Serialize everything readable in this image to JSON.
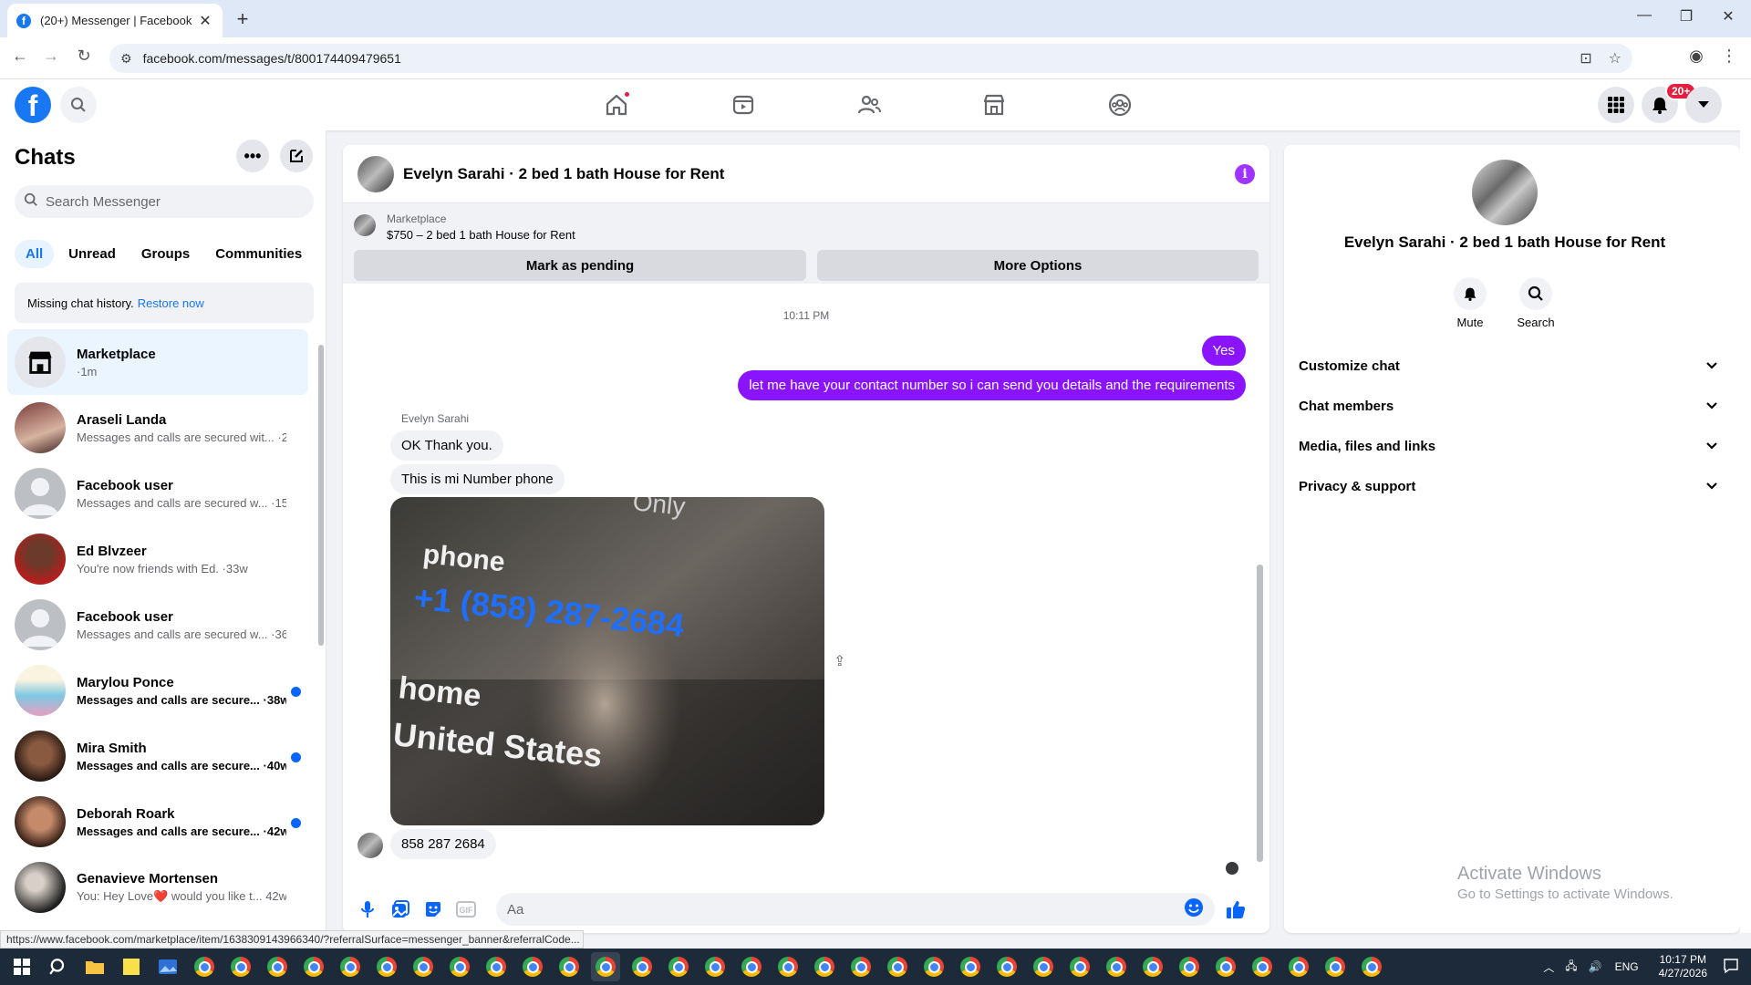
{
  "browser": {
    "tab_title": "(20+) Messenger | Facebook",
    "url": "facebook.com/messages/t/800174409479651",
    "status_url": "https://www.facebook.com/marketplace/item/1638309143966340/?referralSurface=messenger_banner&referralCode..."
  },
  "fb": {
    "notification_count": "20+",
    "logo_letter": "f"
  },
  "left": {
    "title": "Chats",
    "search_placeholder": "Search Messenger",
    "filters": [
      "All",
      "Unread",
      "Groups",
      "Communities"
    ],
    "restore_text": "Missing chat history.",
    "restore_link": "Restore now",
    "chats": [
      {
        "name": "Marketplace",
        "preview": "·1m"
      },
      {
        "name": "Araseli Landa",
        "preview": "Messages and calls are secured wit... ·2w"
      },
      {
        "name": "Facebook user",
        "preview": "Messages and calls are secured w... ·15w"
      },
      {
        "name": "Ed Blvzeer",
        "preview": "You're now friends with Ed. ·33w"
      },
      {
        "name": "Facebook user",
        "preview": "Messages and calls are secured w... ·36w"
      },
      {
        "name": "Marylou Ponce",
        "preview": "Messages and calls are secure... ·38w"
      },
      {
        "name": "Mira Smith",
        "preview": "Messages and calls are secure... ·40w"
      },
      {
        "name": "Deborah Roark",
        "preview": "Messages and calls are secure... ·42w"
      },
      {
        "name": "Genavieve Mortensen",
        "preview": "You: Hey Love❤️ would you like t... 42w"
      }
    ]
  },
  "conversation": {
    "title": "Evelyn Sarahi · 2 bed 1 bath House for Rent",
    "marketplace_label": "Marketplace",
    "listing": "$750 – 2 bed 1 bath House for Rent",
    "mark_pending": "Mark as pending",
    "more_options": "More Options",
    "time": "10:11 PM",
    "outgoing": [
      "Yes",
      "let me have your contact number so i can send you details and the requirements"
    ],
    "sender_name": "Evelyn Sarahi",
    "incoming": [
      "OK Thank you.",
      "This is mi Number phone"
    ],
    "photo_text": {
      "line1": "phone",
      "line2": "+1 (858) 287-2684",
      "line3": "home",
      "line4": "United States",
      "top": "Only"
    },
    "last_incoming": "858 287 2684",
    "composer_placeholder": "Aa"
  },
  "right": {
    "name": "Evelyn Sarahi · 2 bed 1 bath House for Rent",
    "actions": [
      "Mute",
      "Search"
    ],
    "sections": [
      "Customize chat",
      "Chat members",
      "Media, files and links",
      "Privacy & support"
    ],
    "activate_title": "Activate Windows",
    "activate_sub": "Go to Settings to activate Windows."
  },
  "taskbar": {
    "lang": "ENG",
    "time": "10:17 PM",
    "date": "4/27/2026"
  },
  "colors": {
    "fb_blue": "#1877f2",
    "messenger_purple": "#8a14ff",
    "info_purple": "#a033ff",
    "selected_row": "#ebf5ff"
  }
}
